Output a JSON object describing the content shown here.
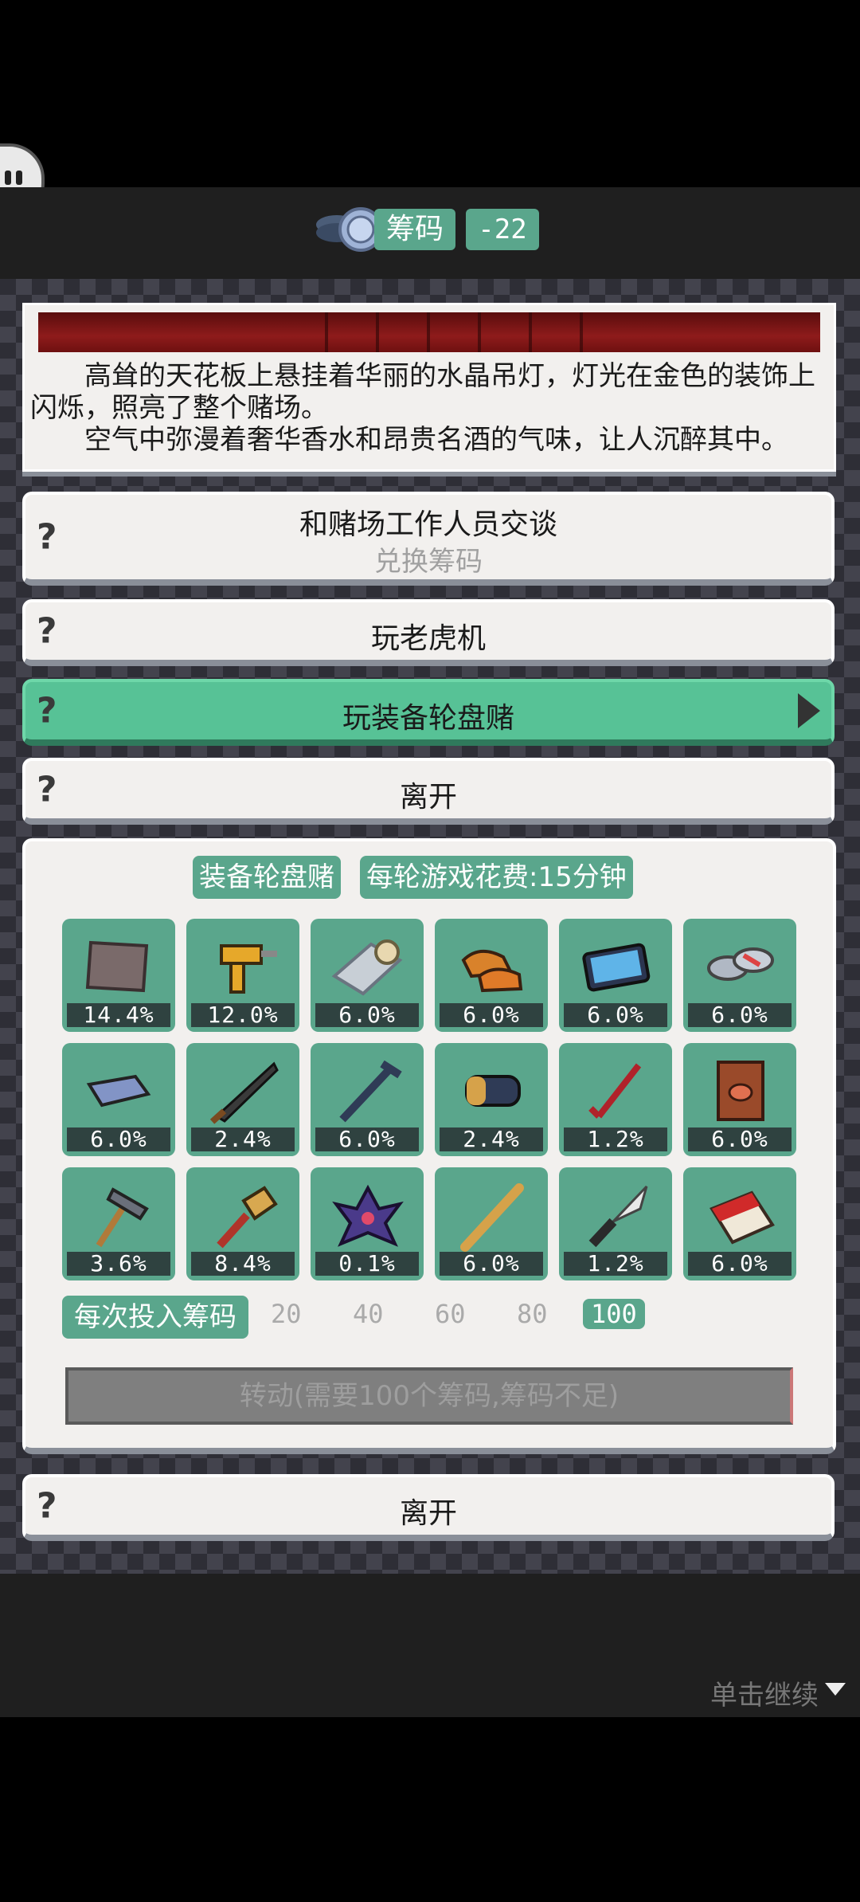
{
  "header": {
    "resource_label": "筹码",
    "resource_value": "-22"
  },
  "story": {
    "paragraph1": "高耸的天花板上悬挂着华丽的水晶吊灯，灯光在金色的装饰上闪烁，照亮了整个赌场。",
    "paragraph2": "空气中弥漫着奢华香水和昂贵名酒的气味，让人沉醉其中。"
  },
  "options": [
    {
      "label": "和赌场工作人员交谈",
      "sub": "兑换筹码",
      "marker": "?"
    },
    {
      "label": "玩老虎机",
      "marker": "?"
    },
    {
      "label": "玩装备轮盘赌",
      "marker": "?",
      "active": true
    },
    {
      "label": "离开",
      "marker": "?"
    }
  ],
  "panel": {
    "title_tag": "装备轮盘赌",
    "cost_tag": "每轮游戏花费:15分钟",
    "items": [
      {
        "icon": "cloth-icon",
        "pct": "14.4%"
      },
      {
        "icon": "drill-icon",
        "pct": "12.0%"
      },
      {
        "icon": "mat-roll-icon",
        "pct": "6.0%"
      },
      {
        "icon": "shoes-icon",
        "pct": "6.0%"
      },
      {
        "icon": "tablet-icon",
        "pct": "6.0%"
      },
      {
        "icon": "sandals-icon",
        "pct": "6.0%"
      },
      {
        "icon": "eraser-icon",
        "pct": "6.0%"
      },
      {
        "icon": "machete-icon",
        "pct": "2.4%"
      },
      {
        "icon": "crowbar-icon",
        "pct": "6.0%"
      },
      {
        "icon": "battery-icon",
        "pct": "2.4%"
      },
      {
        "icon": "red-crowbar-icon",
        "pct": "1.2%"
      },
      {
        "icon": "pouch-book-icon",
        "pct": "6.0%"
      },
      {
        "icon": "hammer-icon",
        "pct": "3.6%"
      },
      {
        "icon": "paintbrush-icon",
        "pct": "8.4%"
      },
      {
        "icon": "crystal-flower-icon",
        "pct": "0.1%"
      },
      {
        "icon": "baseball-bat-icon",
        "pct": "6.0%"
      },
      {
        "icon": "knife-icon",
        "pct": "1.2%"
      },
      {
        "icon": "cigarette-pack-icon",
        "pct": "6.0%"
      }
    ],
    "bet_label": "每次投入筹码",
    "bet_options": [
      "20",
      "40",
      "60",
      "80",
      "100"
    ],
    "bet_selected": "100",
    "spin_label": "转动(需要100个筹码,筹码不足)"
  },
  "leave_bottom": {
    "label": "离开",
    "marker": "?"
  },
  "continue_hint": "单击继续"
}
